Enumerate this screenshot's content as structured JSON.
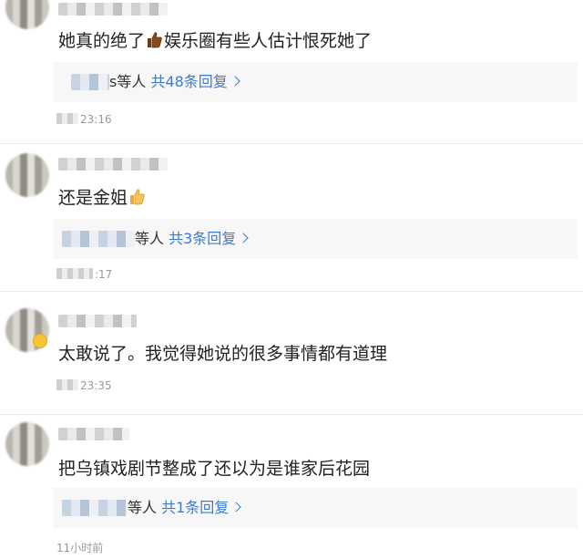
{
  "comments": [
    {
      "text_a": "她真的绝了",
      "text_b": "娱乐圈有些人估计恨死她了",
      "reply_suffix": "s等人",
      "reply_count": "共48条回复",
      "time": "23:16"
    },
    {
      "text_a": "还是金姐",
      "reply_suffix": "等人",
      "reply_count": "共3条回复",
      "time": ":17"
    },
    {
      "text_a": "太敢说了。我觉得她说的很多事情都有道理",
      "time": "23:35"
    },
    {
      "text_a": "把乌镇戏剧节整成了还以为是谁家后花园",
      "reply_suffix": "等人",
      "reply_count": "共1条回复",
      "time": "11小时前"
    }
  ],
  "icons": {
    "thumbs_up": "thumbs-up-emoji",
    "chevron": "chevron-right-icon",
    "verified": "verified-badge-icon"
  },
  "colors": {
    "link": "#3b7bd4",
    "reply_bg": "#f7f7f7",
    "time": "#999999"
  }
}
